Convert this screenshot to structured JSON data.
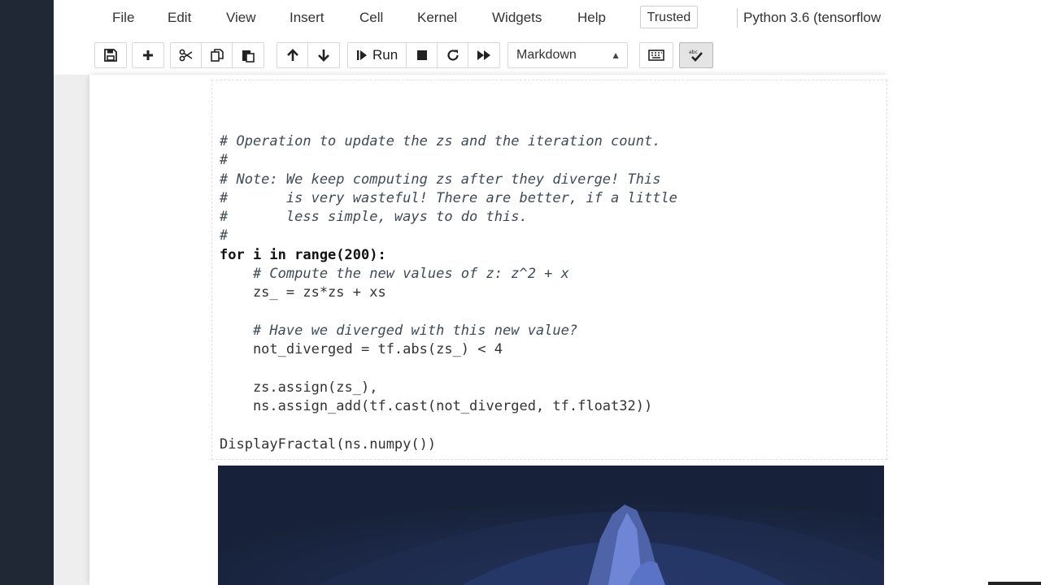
{
  "menubar": {
    "items": [
      "File",
      "Edit",
      "View",
      "Insert",
      "Cell",
      "Kernel",
      "Widgets",
      "Help"
    ],
    "trusted": "Trusted",
    "kernel": "Python 3.6 (tensorflow"
  },
  "toolbar": {
    "run_label": "Run",
    "cell_type": "Markdown"
  },
  "cell": {
    "code_lines": [
      "# Operation to update the zs and the iteration count.",
      "#",
      "# Note: We keep computing zs after they diverge! This",
      "#       is very wasteful! There are better, if a little",
      "#       less simple, ways to do this.",
      "#",
      "for i in range(200):",
      "    # Compute the new values of z: z^2 + x",
      "    zs_ = zs*zs + xs",
      "",
      "    # Have we diverged with this new value?",
      "    not_diverged = tf.abs(zs_) < 4",
      "",
      "    zs.assign(zs_),",
      "    ns.assign_add(tf.cast(not_diverged, tf.float32))",
      "",
      "DisplayFractal(ns.numpy())"
    ]
  },
  "colors": {
    "sidebar": "#1f2834",
    "fractal_background": "#17223a",
    "fractal_accent": "#6f86d6"
  }
}
